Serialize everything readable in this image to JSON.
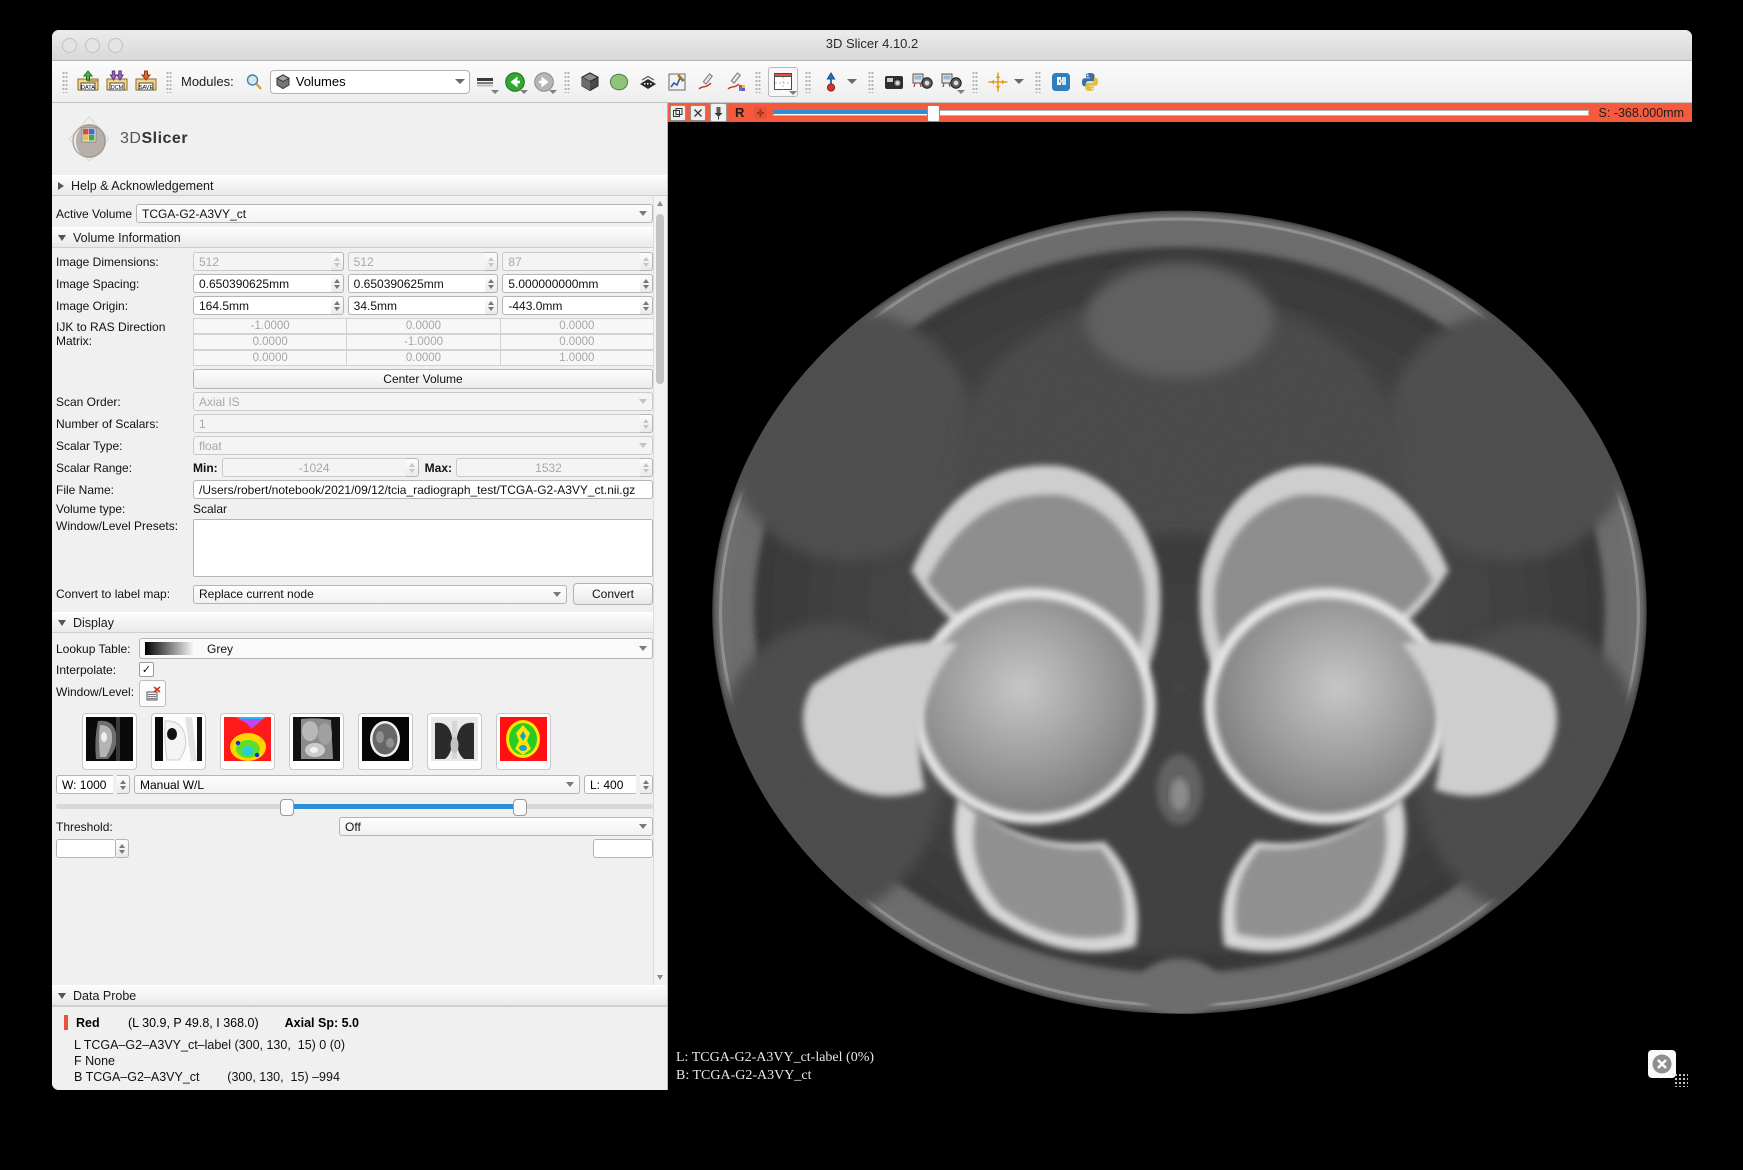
{
  "window": {
    "title": "3D Slicer 4.10.2"
  },
  "toolbar": {
    "icons": [
      {
        "name": "load-data-icon",
        "label": "DATA"
      },
      {
        "name": "load-dicom-icon",
        "label": "DCM"
      },
      {
        "name": "save-data-icon",
        "label": "SAVE"
      }
    ],
    "modules_label": "Modules:",
    "search_icon": "search-icon",
    "module_selected": "Volumes",
    "right_icons": [
      "layout-icon",
      "history-back-icon",
      "history-forward-icon",
      "volume-rendering-icon",
      "models-icon",
      "data-icon",
      "charts-icon",
      "markups-icon",
      "editor-icon",
      "layout-chooser-icon",
      "mouse-mode-icon",
      "screenshot-icon",
      "scene-views-icon",
      "scene-views-capture-icon",
      "crosshair-icon",
      "extension-manager-icon",
      "python-console-icon"
    ]
  },
  "sidebar": {
    "logo_text_prefix": "3D",
    "logo_text_suffix": "Slicer",
    "help_section": "Help & Acknowledgement",
    "active_volume_label": "Active Volume",
    "active_volume_value": "TCGA-G2-A3VY_ct",
    "volume_information": "Volume Information",
    "fields": {
      "image_dimensions_label": "Image Dimensions:",
      "image_dimensions": [
        "512",
        "512",
        "87"
      ],
      "image_spacing_label": "Image Spacing:",
      "image_spacing": [
        "0.650390625mm",
        "0.650390625mm",
        "5.000000000mm"
      ],
      "image_origin_label": "Image Origin:",
      "image_origin": [
        "164.5mm",
        "34.5mm",
        "-443.0mm"
      ],
      "ijk_matrix_label": "IJK to RAS Direction Matrix:",
      "ijk_matrix": [
        [
          "-1.0000",
          "0.0000",
          "0.0000"
        ],
        [
          "0.0000",
          "-1.0000",
          "0.0000"
        ],
        [
          "0.0000",
          "0.0000",
          "1.0000"
        ]
      ],
      "center_volume_button": "Center Volume",
      "scan_order_label": "Scan Order:",
      "scan_order_value": "Axial IS",
      "number_of_scalars_label": "Number of Scalars:",
      "number_of_scalars_value": "1",
      "scalar_type_label": "Scalar Type:",
      "scalar_type_value": "float",
      "scalar_range_label": "Scalar Range:",
      "scalar_min_label": "Min:",
      "scalar_min_value": "-1024",
      "scalar_max_label": "Max:",
      "scalar_max_value": "1532",
      "file_name_label": "File Name:",
      "file_name_value": "/Users/robert/notebook/2021/09/12/tcia_radiograph_test/TCGA-G2-A3VY_ct.nii.gz",
      "volume_type_label": "Volume type:",
      "volume_type_value": "Scalar",
      "window_level_presets_label": "Window/Level Presets:",
      "window_level_presets_value": "",
      "convert_label": "Convert to label map:",
      "convert_value": "Replace current node",
      "convert_button": "Convert"
    },
    "display_section": "Display",
    "display": {
      "lookup_table_label": "Lookup Table:",
      "lookup_table_value": "Grey",
      "interpolate_label": "Interpolate:",
      "interpolate_checked": "✓",
      "window_level_label": "Window/Level:",
      "presets": [
        {
          "name": "preset-ct-head-neck"
        },
        {
          "name": "preset-ct-bone"
        },
        {
          "name": "preset-pet-color"
        },
        {
          "name": "preset-ct-abdomen"
        },
        {
          "name": "preset-ct-brain"
        },
        {
          "name": "preset-ct-lung"
        },
        {
          "name": "preset-mr-color"
        }
      ],
      "w_value": "W: 1000",
      "wl_mode": "Manual W/L",
      "l_value": "L: 400",
      "threshold_label": "Threshold:",
      "threshold_value": "Off"
    },
    "data_probe_section": "Data Probe",
    "data_probe": {
      "slice_name": "Red",
      "coords": "(L 30.9, P 49.8, I 368.0)",
      "spacing": "Axial Sp: 5.0",
      "lines": [
        "L TCGA–G2–A3VY_ct–label (300, 130,  15) 0 (0)",
        "F None",
        "B TCGA–G2–A3VY_ct        (300, 130,  15) –994"
      ]
    }
  },
  "slice_view": {
    "pin_icon": "pin-icon",
    "popup_icon": "popup-window-icon",
    "close_icon": "close-icon",
    "view_letter": "R",
    "link_icon": "link-views-icon",
    "slice_offset": "S: -368.000mm",
    "overlay_label": "L: TCGA-G2-A3VY_ct-label (0%)",
    "overlay_background": "B: TCGA-G2-A3VY_ct",
    "close_button_icon": "close-circle-icon"
  },
  "colors": {
    "slice_red": "#f55a3c",
    "accent_blue": "#2d8fd5",
    "probe_red": "#e8543a"
  }
}
